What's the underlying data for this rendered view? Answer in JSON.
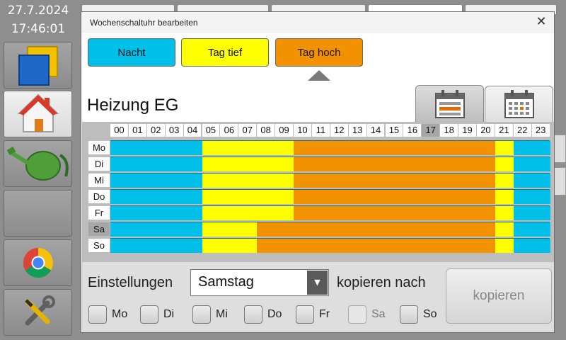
{
  "clock": {
    "date": "27.7.2024",
    "time": "17:46:01"
  },
  "sidebar": {
    "items": [
      {
        "name": "windows-icon"
      },
      {
        "name": "home-icon"
      },
      {
        "name": "watering-can-icon"
      },
      {
        "name": "empty"
      },
      {
        "name": "chrome-icon"
      },
      {
        "name": "tools-icon"
      }
    ]
  },
  "dialog": {
    "title": "Wochenschaltuhr bearbeiten",
    "close": "✕",
    "modes": [
      {
        "label": "Nacht",
        "color": "#00bfe8"
      },
      {
        "label": "Tag tief",
        "color": "#ffff00"
      },
      {
        "label": "Tag hoch",
        "color": "#f39200"
      }
    ],
    "selected_mode": "Tag hoch",
    "heading": "Heizung EG"
  },
  "schedule": {
    "hours": [
      "00",
      "01",
      "02",
      "03",
      "04",
      "05",
      "06",
      "07",
      "08",
      "09",
      "10",
      "11",
      "12",
      "13",
      "14",
      "15",
      "16",
      "17",
      "18",
      "19",
      "20",
      "21",
      "22",
      "23"
    ],
    "current_hour": "17",
    "current_day": "Sa",
    "colors": {
      "Nacht": "#00bfe8",
      "Tag tief": "#ffff00",
      "Tag hoch": "#f39200"
    },
    "days": [
      {
        "label": "Mo",
        "segments": [
          {
            "from": 0,
            "to": 5,
            "mode": "Nacht"
          },
          {
            "from": 5,
            "to": 10,
            "mode": "Tag tief"
          },
          {
            "from": 10,
            "to": 21,
            "mode": "Tag hoch"
          },
          {
            "from": 21,
            "to": 22,
            "mode": "Tag tief"
          },
          {
            "from": 22,
            "to": 24,
            "mode": "Nacht"
          }
        ]
      },
      {
        "label": "Di",
        "segments": [
          {
            "from": 0,
            "to": 5,
            "mode": "Nacht"
          },
          {
            "from": 5,
            "to": 10,
            "mode": "Tag tief"
          },
          {
            "from": 10,
            "to": 21,
            "mode": "Tag hoch"
          },
          {
            "from": 21,
            "to": 22,
            "mode": "Tag tief"
          },
          {
            "from": 22,
            "to": 24,
            "mode": "Nacht"
          }
        ]
      },
      {
        "label": "Mi",
        "segments": [
          {
            "from": 0,
            "to": 5,
            "mode": "Nacht"
          },
          {
            "from": 5,
            "to": 10,
            "mode": "Tag tief"
          },
          {
            "from": 10,
            "to": 21,
            "mode": "Tag hoch"
          },
          {
            "from": 21,
            "to": 22,
            "mode": "Tag tief"
          },
          {
            "from": 22,
            "to": 24,
            "mode": "Nacht"
          }
        ]
      },
      {
        "label": "Do",
        "segments": [
          {
            "from": 0,
            "to": 5,
            "mode": "Nacht"
          },
          {
            "from": 5,
            "to": 10,
            "mode": "Tag tief"
          },
          {
            "from": 10,
            "to": 21,
            "mode": "Tag hoch"
          },
          {
            "from": 21,
            "to": 22,
            "mode": "Tag tief"
          },
          {
            "from": 22,
            "to": 24,
            "mode": "Nacht"
          }
        ]
      },
      {
        "label": "Fr",
        "segments": [
          {
            "from": 0,
            "to": 5,
            "mode": "Nacht"
          },
          {
            "from": 5,
            "to": 10,
            "mode": "Tag tief"
          },
          {
            "from": 10,
            "to": 21,
            "mode": "Tag hoch"
          },
          {
            "from": 21,
            "to": 22,
            "mode": "Tag tief"
          },
          {
            "from": 22,
            "to": 24,
            "mode": "Nacht"
          }
        ]
      },
      {
        "label": "Sa",
        "segments": [
          {
            "from": 0,
            "to": 5,
            "mode": "Nacht"
          },
          {
            "from": 5,
            "to": 8,
            "mode": "Tag tief"
          },
          {
            "from": 8,
            "to": 21,
            "mode": "Tag hoch"
          },
          {
            "from": 21,
            "to": 22,
            "mode": "Tag tief"
          },
          {
            "from": 22,
            "to": 24,
            "mode": "Nacht"
          }
        ]
      },
      {
        "label": "So",
        "segments": [
          {
            "from": 0,
            "to": 5,
            "mode": "Nacht"
          },
          {
            "from": 5,
            "to": 8,
            "mode": "Tag tief"
          },
          {
            "from": 8,
            "to": 21,
            "mode": "Tag hoch"
          },
          {
            "from": 21,
            "to": 22,
            "mode": "Tag tief"
          },
          {
            "from": 22,
            "to": 24,
            "mode": "Nacht"
          }
        ]
      }
    ]
  },
  "settings": {
    "label": "Einstellungen",
    "selected_day": "Samstag",
    "copy_to_label": "kopieren nach",
    "copy_button": "kopieren",
    "checkboxes": [
      {
        "label": "Mo",
        "checked": false,
        "disabled": false
      },
      {
        "label": "Di",
        "checked": false,
        "disabled": false
      },
      {
        "label": "Mi",
        "checked": false,
        "disabled": false
      },
      {
        "label": "Do",
        "checked": false,
        "disabled": false
      },
      {
        "label": "Fr",
        "checked": false,
        "disabled": false
      },
      {
        "label": "Sa",
        "checked": false,
        "disabled": true
      },
      {
        "label": "So",
        "checked": false,
        "disabled": false
      }
    ]
  }
}
